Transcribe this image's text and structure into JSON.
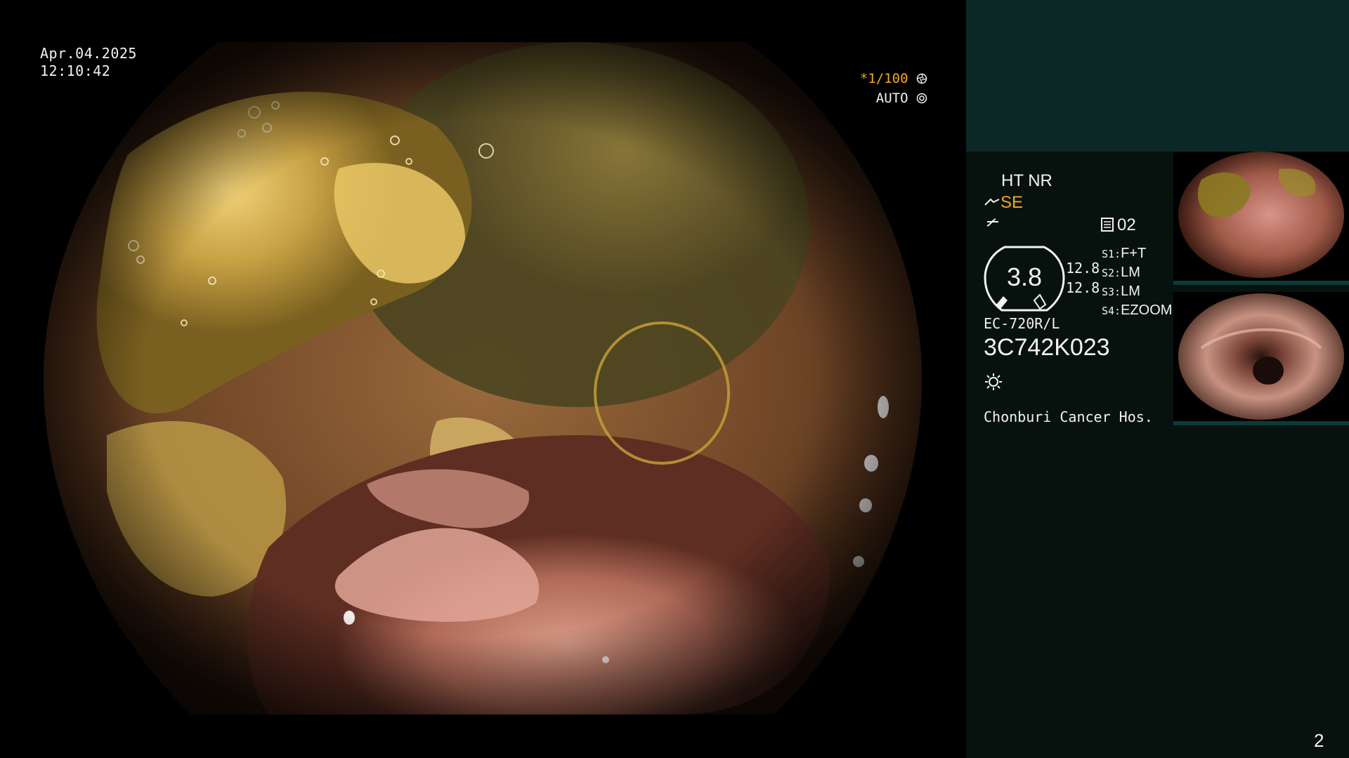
{
  "overlay": {
    "date": "Apr.04.2025",
    "time": "12:10:42",
    "shutter": "*1/100",
    "iris_mode": "AUTO"
  },
  "panel": {
    "ht_nr": "HT NR",
    "se": "SE",
    "record_count": "02",
    "zoom_value": "3.8",
    "zoom_line1": "12.8",
    "zoom_line2": "12.8",
    "switches": [
      {
        "key": "S1:",
        "value": "F+T"
      },
      {
        "key": "S2:",
        "value": "LM"
      },
      {
        "key": "S3:",
        "value": "LM"
      },
      {
        "key": "S4:",
        "value": "EZOOM"
      }
    ],
    "scope_model": "EC-720R/L",
    "scope_serial": "3C742K023",
    "hospital": "Chonburi Cancer Hos.",
    "page_number": "2"
  },
  "colors": {
    "accent_orange": "#f5a623",
    "panel_bg": "#07120f",
    "panel_top_bg": "#0c2826"
  },
  "icons": [
    "shutter-icon",
    "iris-icon",
    "scope-angle-icon",
    "enhance-icon",
    "record-icon",
    "light-icon"
  ]
}
